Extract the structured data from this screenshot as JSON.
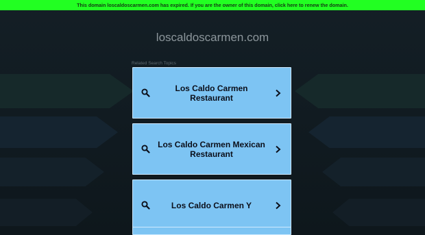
{
  "banner": {
    "text": "This domain loscaldoscarmen.com has expired. If you are the owner of this domain, click here to renew the domain."
  },
  "site": {
    "domain": "loscaldoscarmen.com"
  },
  "related": {
    "heading": "Related Search Topics",
    "items": [
      {
        "label": "Los Caldo Carmen Restaurant",
        "icon": "search-icon"
      },
      {
        "label": "Los Caldo Carmen Mexican Restaurant",
        "icon": "search-icon"
      },
      {
        "label": "Los Caldo Carmen Y",
        "icon": "search-icon"
      },
      {
        "label": "",
        "icon": "search-icon"
      }
    ]
  },
  "colors": {
    "banner_bg": "#22ff22",
    "card_bg": "#7dc4f3",
    "page_bg": "#0f1a20"
  }
}
